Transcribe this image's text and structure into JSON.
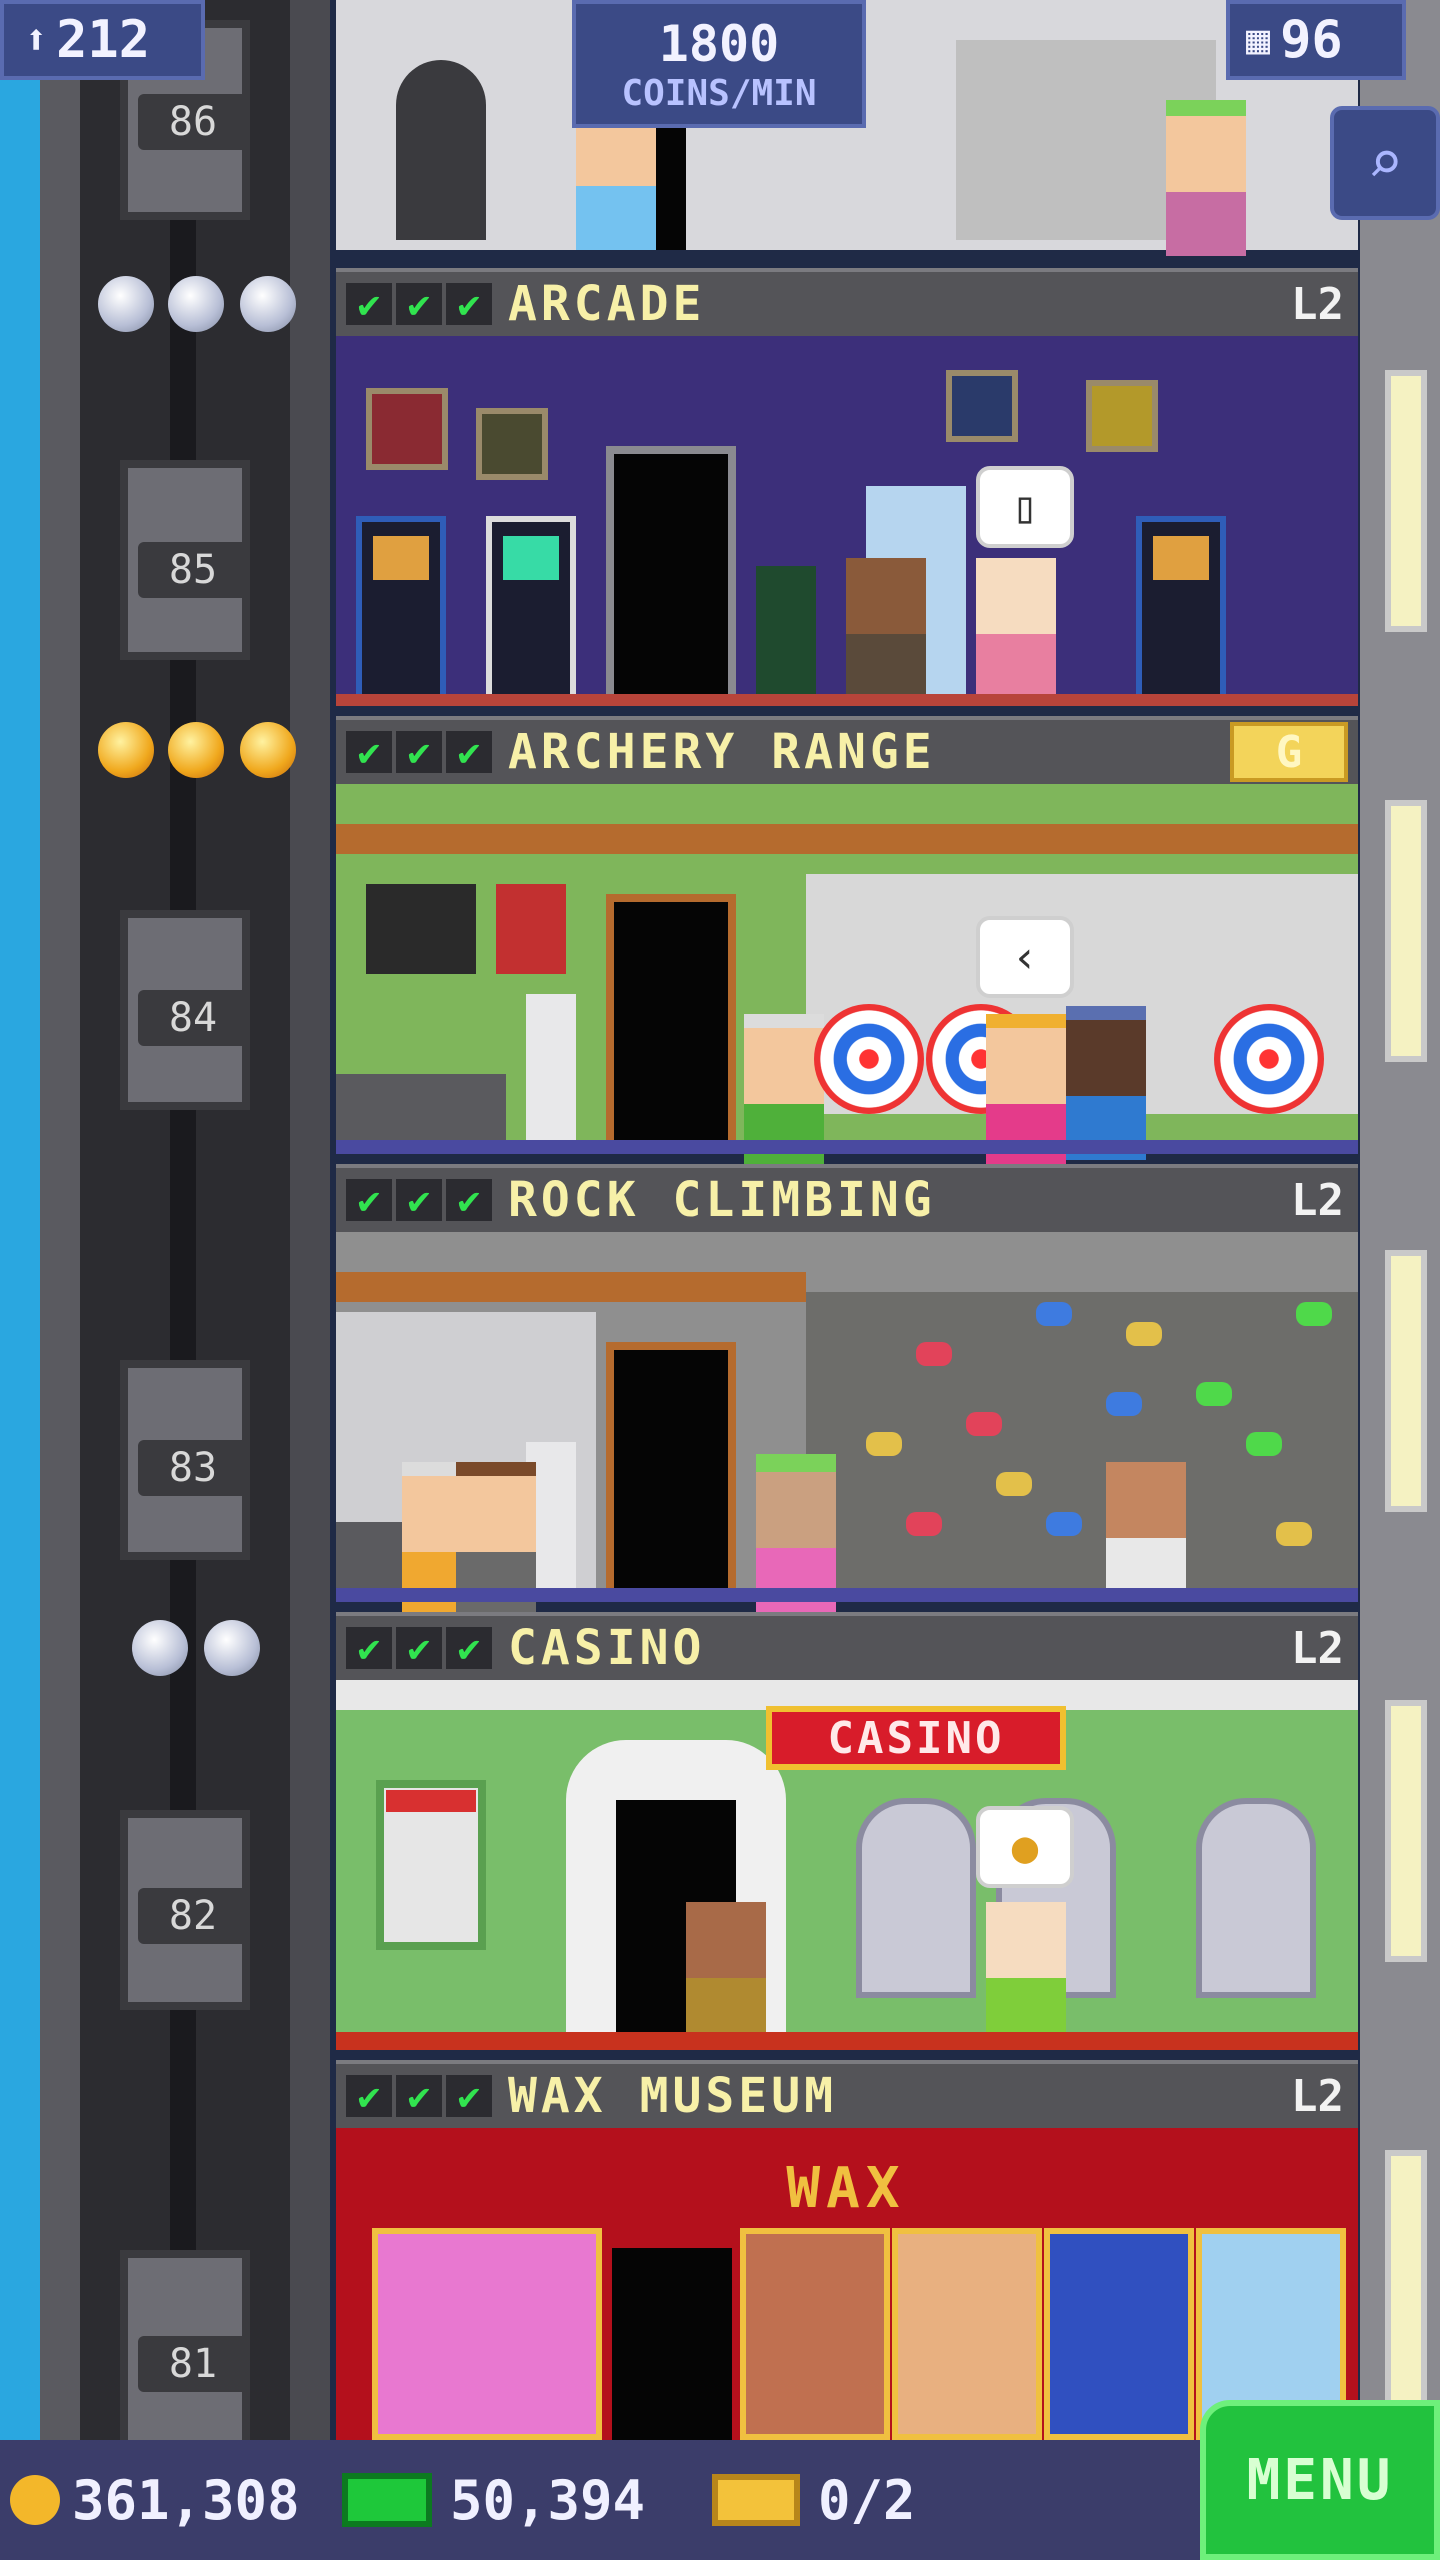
{
  "hud": {
    "population": "212",
    "coins_per_min_value": "1800",
    "coins_per_min_label": "COINS/MIN",
    "floors_count": "96"
  },
  "elevator": {
    "floor_labels": [
      "86",
      "85",
      "84",
      "83",
      "82",
      "81"
    ]
  },
  "floors": [
    {
      "name": "ARCADE",
      "level": "L2",
      "stars": 3,
      "star_type": "silver"
    },
    {
      "name": "ARCHERY RANGE",
      "level": "G",
      "stars": 3,
      "star_type": "gold"
    },
    {
      "name": "ROCK CLIMBING",
      "level": "L2",
      "stars": 0,
      "star_type": "none"
    },
    {
      "name": "CASINO",
      "level": "L2",
      "stars": 2,
      "star_type": "silver"
    },
    {
      "name": "WAX MUSEUM",
      "level": "L2",
      "stars": 0,
      "star_type": "none"
    }
  ],
  "check_glyph": "✔",
  "room_signs": {
    "casino": "CASINO",
    "wax": "WAX"
  },
  "bubbles": {
    "arcade": "▯",
    "archery": "‹",
    "casino": "●"
  },
  "bottom": {
    "coins": "361,308",
    "bux": "50,394",
    "tickets": "0/2",
    "menu_label": "MENU"
  },
  "colors": {
    "arcade_wall": "#3c2f7a",
    "archery_wall": "#7fb65b",
    "climbing_wall": "#8f8f8f",
    "casino_wall": "#79be6a",
    "wax_wall": "#b4101c"
  }
}
